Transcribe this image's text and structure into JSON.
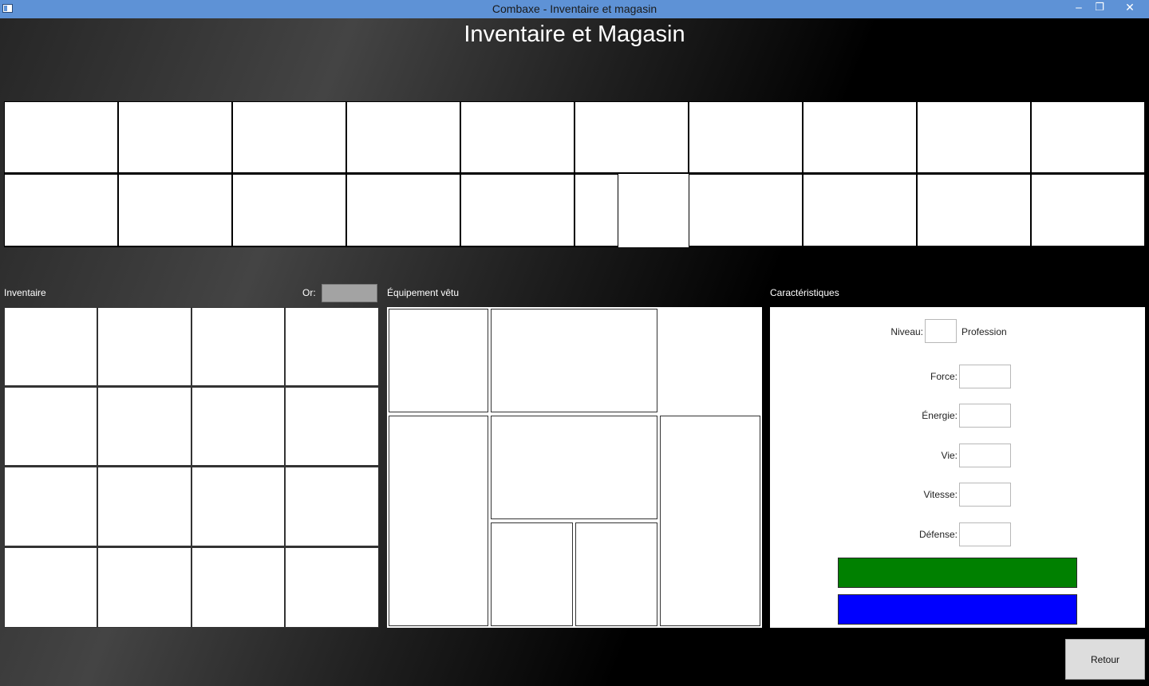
{
  "window": {
    "title": "Combaxe - Inventaire et magasin",
    "controls": {
      "minimize": "‒",
      "maximize": "❐",
      "close": "✕"
    }
  },
  "page": {
    "title": "Inventaire et Magasin"
  },
  "inventory": {
    "label": "Inventaire",
    "gold_label": "Or:",
    "gold_value": ""
  },
  "equipment": {
    "label": "Équipement vêtu"
  },
  "stats": {
    "label": "Caractéristiques",
    "level_label": "Niveau:",
    "level_value": "",
    "profession_label": "Profession",
    "fields": [
      {
        "label": "Force:",
        "value": ""
      },
      {
        "label": "Énergie:",
        "value": ""
      },
      {
        "label": "Vie:",
        "value": ""
      },
      {
        "label": "Vitesse:",
        "value": ""
      },
      {
        "label": "Défense:",
        "value": ""
      }
    ],
    "bar_colors": {
      "health": "#008000",
      "energy": "#0000ff"
    }
  },
  "buttons": {
    "back": "Retour"
  },
  "colors": {
    "titlebar": "#5e92d6",
    "gold_field": "#a3a3a3"
  }
}
